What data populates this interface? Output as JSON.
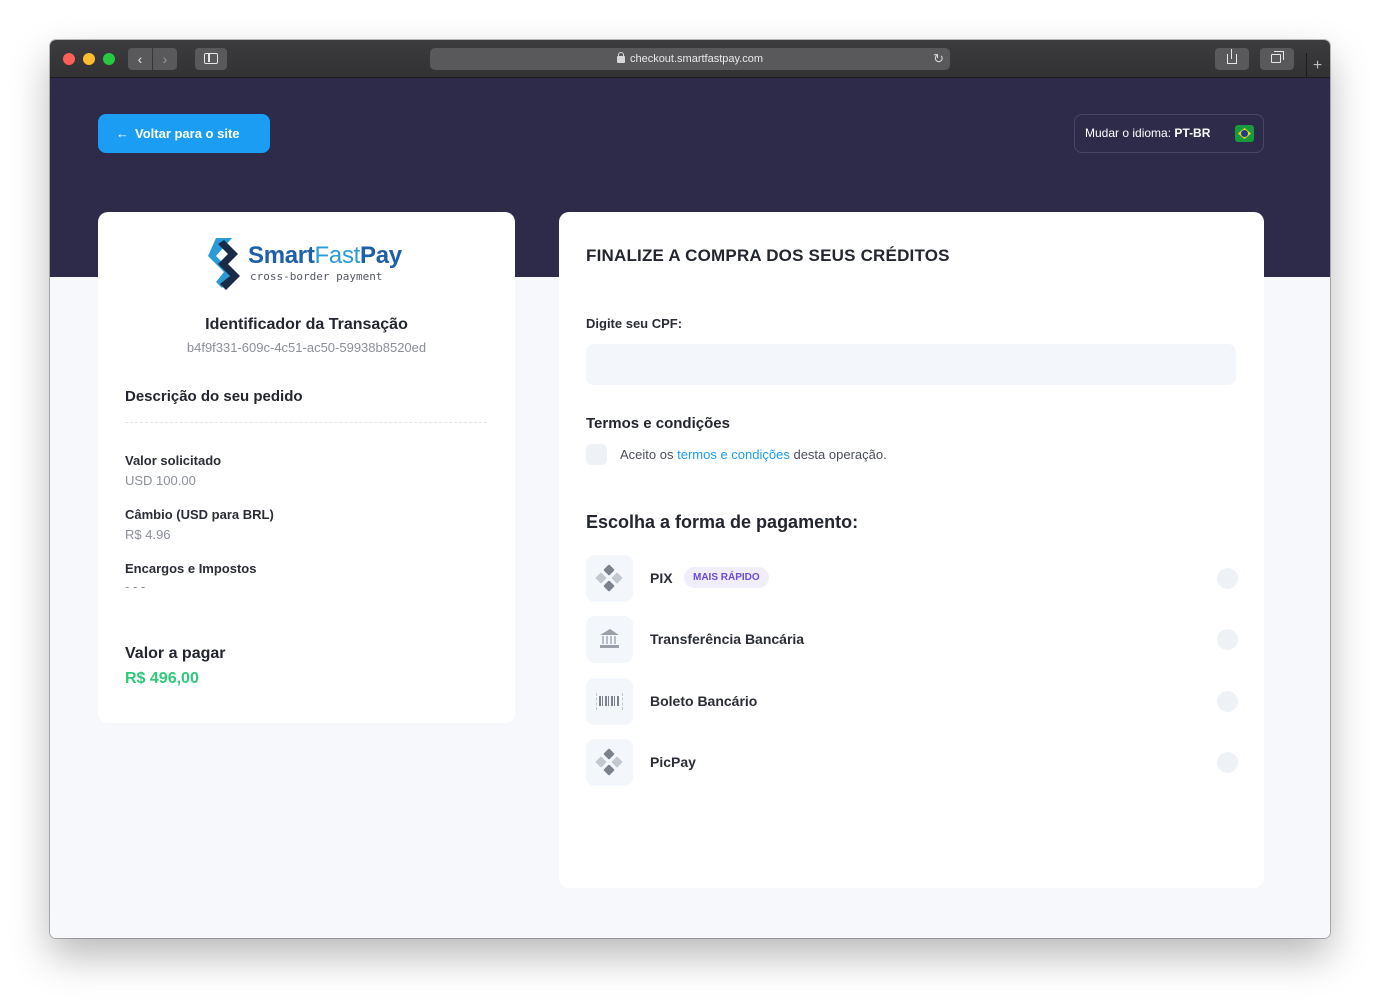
{
  "browser": {
    "url": "checkout.smartfastpay.com"
  },
  "header": {
    "back_label": "Voltar para o site",
    "language_label": "Mudar o idioma:",
    "language_value": "PT-BR"
  },
  "summary": {
    "logo_brand_bold": "Smart",
    "logo_brand_light": "Fast",
    "logo_brand_end": "Pay",
    "logo_tagline": "cross-border payment",
    "transaction_title": "Identificador da Transação",
    "transaction_id": "b4f9f331-609c-4c51-ac50-59938b8520ed",
    "description_title": "Descrição do seu pedido",
    "requested_label": "Valor solicitado",
    "requested_value": "USD 100.00",
    "exchange_label": "Câmbio (USD para BRL)",
    "exchange_value": "R$ 4.96",
    "fees_label": "Encargos e Impostos",
    "fees_value": "- - -",
    "total_label": "Valor a pagar",
    "total_value": "R$ 496,00"
  },
  "checkout": {
    "title": "FINALIZE A COMPRA DOS SEUS CRÉDITOS",
    "cpf_label": "Digite seu CPF:",
    "cpf_value": "",
    "terms_title": "Termos e condições",
    "terms_prefix": "Aceito os",
    "terms_link": "termos e condições",
    "terms_suffix": "desta operação.",
    "payment_title": "Escolha a forma de pagamento:",
    "methods": [
      {
        "name": "PIX",
        "icon": "pix-icon",
        "badge": "MAIS RÁPIDO"
      },
      {
        "name": "Transferência Bancária",
        "icon": "bank-icon"
      },
      {
        "name": "Boleto Bancário",
        "icon": "barcode-icon"
      },
      {
        "name": "PicPay",
        "icon": "pix-icon"
      }
    ]
  },
  "colors": {
    "hero_bg": "#2e2a4a",
    "accent": "#1a9df2",
    "total_green": "#2ec97a",
    "badge_purple": "#6d4bd6"
  }
}
